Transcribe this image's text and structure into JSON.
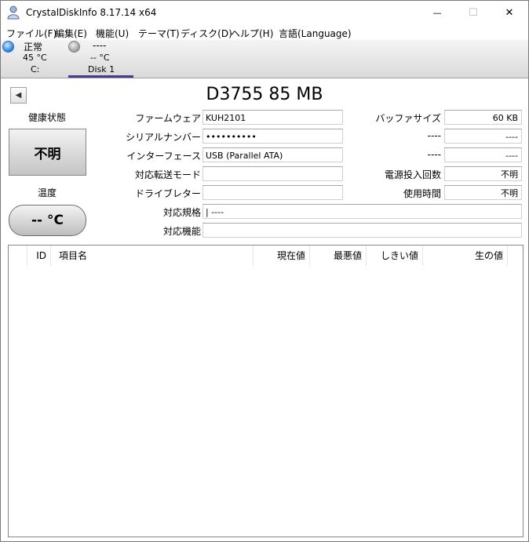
{
  "window": {
    "title": "CrystalDiskInfo 8.17.14 x64",
    "min_glyph": "—",
    "max_glyph": "☐",
    "close_glyph": "✕"
  },
  "menu": [
    "ファイル(F)",
    "編集(E)",
    "機能(U)",
    "テーマ(T)",
    "ディスク(D)",
    "ヘルプ(H)",
    "言語(Language)"
  ],
  "disks": [
    {
      "status": "正常",
      "temp": "45 °C",
      "name": "C:",
      "dot_color": "#3a8de0"
    },
    {
      "status": "----",
      "temp": "-- °C",
      "name": "Disk 1",
      "dot_color": "#a8a8a8"
    }
  ],
  "nav": {
    "prev_glyph": "◀"
  },
  "model": "D3755 85 MB",
  "health": {
    "label": "健康状態",
    "value": "不明"
  },
  "temperature": {
    "label": "温度",
    "value": "-- °C"
  },
  "info": {
    "firmware_label": "ファームウェア",
    "firmware": "KUH2101",
    "serial_label": "シリアルナンバー",
    "serial": "••••••••••",
    "interface_label": "インターフェース",
    "interface": "USB (Parallel ATA)",
    "transfer_label": "対応転送モード",
    "transfer": "",
    "drive_letter_label": "ドライブレター",
    "drive_letter": "",
    "standard_label": "対応規格",
    "standard": "| ----",
    "features_label": "対応機能",
    "features": "",
    "buffer_label": "バッファサイズ",
    "buffer": "60 KB",
    "right2_label": "----",
    "right2": "----",
    "right3_label": "----",
    "right3": "----",
    "power_count_label": "電源投入回数",
    "power_count": "不明",
    "power_hours_label": "使用時間",
    "power_hours": "不明"
  },
  "table": {
    "columns": [
      "",
      "ID",
      "項目名",
      "現在値",
      "最悪値",
      "しきい値",
      "生の値"
    ],
    "rows": []
  }
}
